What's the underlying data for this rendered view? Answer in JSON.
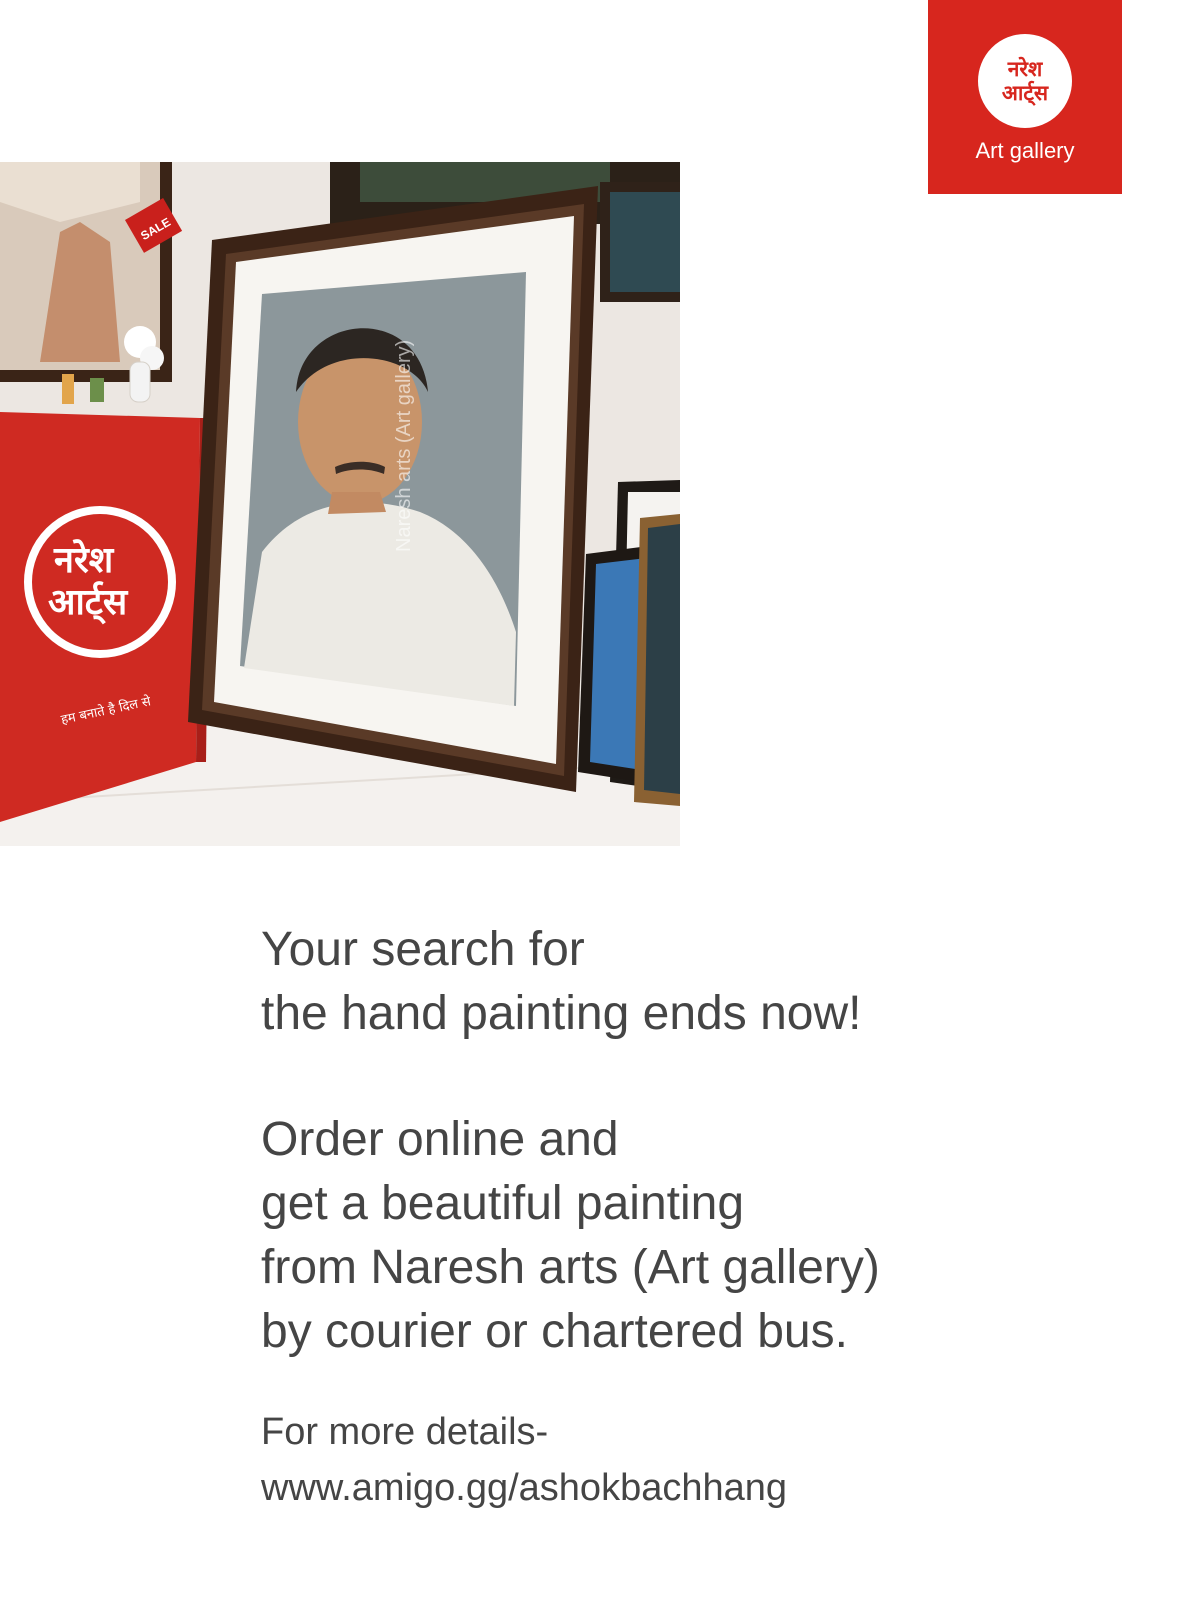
{
  "brand": {
    "logo_line1": "नरेश",
    "logo_line2": "आर्ट्स",
    "caption": "Art gallery",
    "color": "#d7261e"
  },
  "photo": {
    "sale_tag": "SALE",
    "banner_line1": "नरेश",
    "banner_line2": "आर्ट्स",
    "banner_tagline": "हम बनाते है दिल से",
    "watermark": "Naresh arts (Art gallery)"
  },
  "headline": {
    "line1": "Your search for",
    "line2": "the hand painting ends now!"
  },
  "body": {
    "line1": "Order online and",
    "line2": "get a beautiful painting",
    "line3": "from Naresh arts (Art gallery)",
    "line4": "by courier or chartered bus."
  },
  "details": {
    "label": "For more details-",
    "url": "www.amigo.gg/ashokbachhang"
  }
}
